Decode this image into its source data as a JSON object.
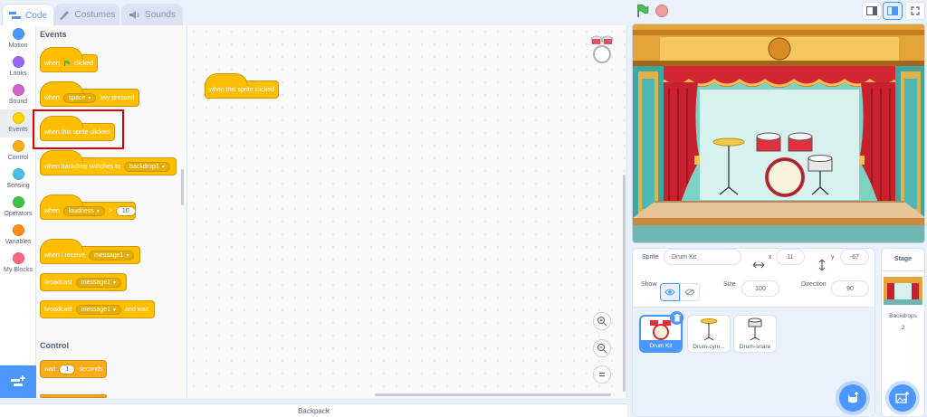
{
  "tabs": {
    "code": "Code",
    "costumes": "Costumes",
    "sounds": "Sounds"
  },
  "categories": [
    {
      "label": "Motion",
      "color": "#4c97ff"
    },
    {
      "label": "Looks",
      "color": "#9966ff"
    },
    {
      "label": "Sound",
      "color": "#cf63cf"
    },
    {
      "label": "Events",
      "color": "#ffd500"
    },
    {
      "label": "Control",
      "color": "#ffab19"
    },
    {
      "label": "Sensing",
      "color": "#4cbfe6"
    },
    {
      "label": "Operators",
      "color": "#40bf4a"
    },
    {
      "label": "Variables",
      "color": "#ff8c1a"
    },
    {
      "label": "My Blocks",
      "color": "#ff6680"
    }
  ],
  "palette": {
    "events_title": "Events",
    "control_title": "Control",
    "when": "when",
    "clicked": "clicked",
    "space": "space",
    "key_pressed": "key pressed",
    "sprite_clicked": "when this sprite clicked",
    "backdrop_switches": "when backdrop switches to",
    "backdrop1": "backdrop1",
    "loudness": "loudness",
    "gt": ">",
    "ten": "10",
    "when_i_receive": "when I receive",
    "message1": "message1",
    "broadcast": "broadcast",
    "and_wait": "and wait",
    "wait": "wait",
    "one": "1",
    "seconds": "seconds"
  },
  "script": {
    "block": "when this sprite clicked"
  },
  "backpack": "Backpack",
  "sprite_info": {
    "sprite_label": "Sprite",
    "sprite_name": "Drum Kit",
    "x_label": "x",
    "x_value": "11",
    "y_label": "y",
    "y_value": "-67",
    "show_label": "Show",
    "size_label": "Size",
    "size_value": "100",
    "direction_label": "Direction",
    "direction_value": "90"
  },
  "sprites": [
    "Drum Kit",
    "Drum-cym...",
    "Drum-snare"
  ],
  "stage_pane": {
    "title": "Stage",
    "backdrops_label": "Backdrops",
    "backdrops_count": "2"
  },
  "colors": {
    "accent": "#4c97ff",
    "events": "#ffbf00",
    "highlight": "#d80000"
  }
}
